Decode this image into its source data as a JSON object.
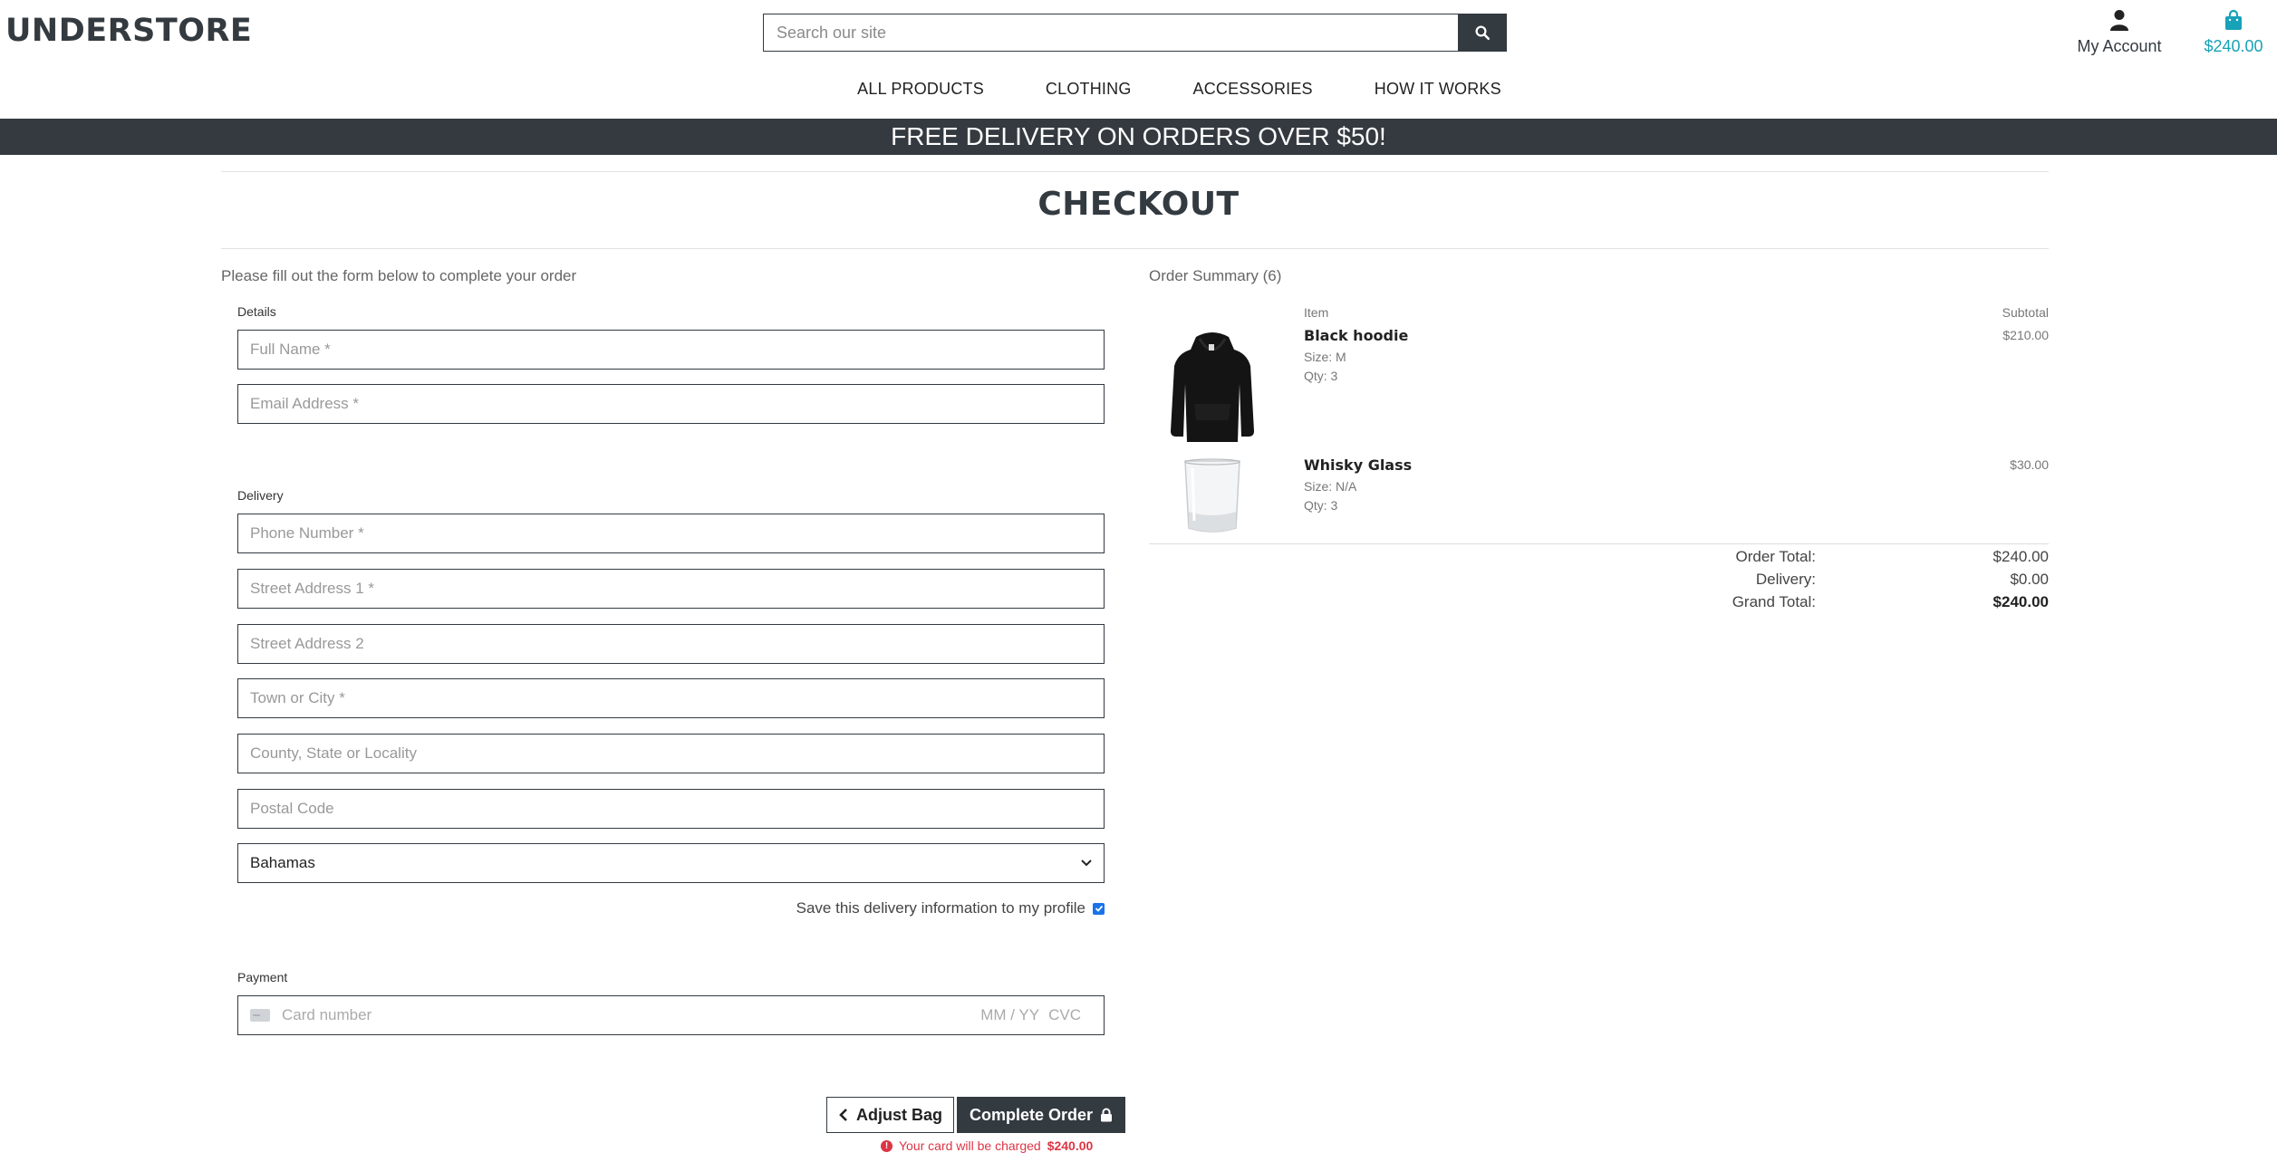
{
  "header": {
    "logo": "UNDERSTORE",
    "search_placeholder": "Search our site",
    "account_label": "My Account",
    "bag_total": "$240.00"
  },
  "nav": {
    "items": [
      "ALL PRODUCTS",
      "CLOTHING",
      "ACCESSORIES",
      "HOW IT WORKS"
    ]
  },
  "banner": "FREE DELIVERY ON ORDERS OVER $50!",
  "page_title": "CHECKOUT",
  "form": {
    "intro": "Please fill out the form below to complete your order",
    "details_label": "Details",
    "full_name_placeholder": "Full Name *",
    "email_placeholder": "Email Address *",
    "delivery_label": "Delivery",
    "phone_placeholder": "Phone Number *",
    "street1_placeholder": "Street Address 1 *",
    "street2_placeholder": "Street Address 2",
    "town_placeholder": "Town or City *",
    "county_placeholder": "County, State or Locality",
    "postcode_placeholder": "Postal Code",
    "country_selected": "Bahamas",
    "save_info_label": "Save this delivery information to my profile",
    "save_info_checked": true,
    "payment_label": "Payment",
    "card_number_placeholder": "Card number",
    "card_expiry_placeholder": "MM / YY",
    "card_cvc_placeholder": "CVC"
  },
  "actions": {
    "adjust_bag": "Adjust Bag",
    "complete_order": "Complete Order",
    "charge_text": "Your card will be charged",
    "charge_amount": "$240.00"
  },
  "summary": {
    "title": "Order Summary (6)",
    "col_item": "Item",
    "col_subtotal": "Subtotal",
    "items": [
      {
        "name": "Black hoodie",
        "size": "Size: M",
        "qty": "Qty: 3",
        "subtotal": "$210.00",
        "icon": "hoodie-image"
      },
      {
        "name": "Whisky Glass",
        "size": "Size: N/A",
        "qty": "Qty: 3",
        "subtotal": "$30.00",
        "icon": "glass-image"
      }
    ],
    "order_total_label": "Order Total:",
    "order_total": "$240.00",
    "delivery_label": "Delivery:",
    "delivery": "$0.00",
    "grand_total_label": "Grand Total:",
    "grand_total": "$240.00"
  },
  "colors": {
    "dark": "#333a40",
    "bag_accent": "#17a2b8",
    "error": "#dc3545"
  }
}
